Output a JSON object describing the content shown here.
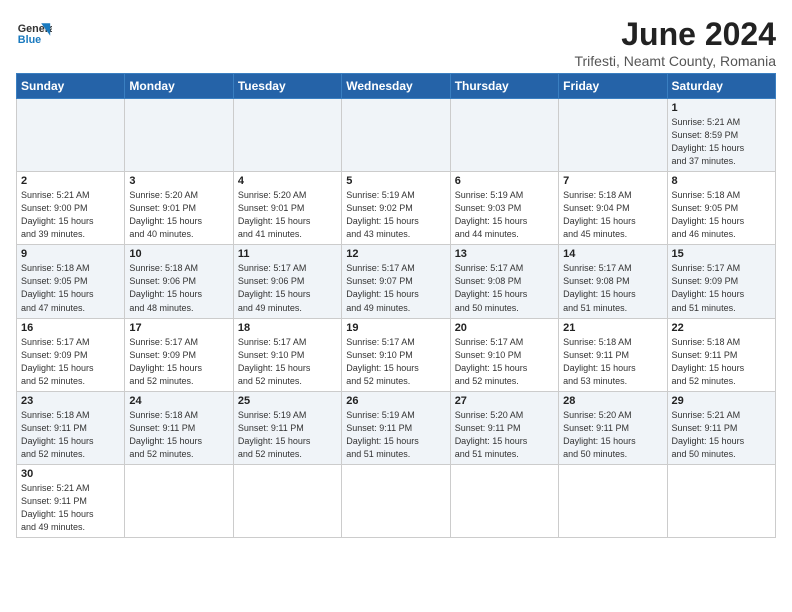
{
  "header": {
    "logo_general": "General",
    "logo_blue": "Blue",
    "month_year": "June 2024",
    "subtitle": "Trifesti, Neamt County, Romania"
  },
  "weekdays": [
    "Sunday",
    "Monday",
    "Tuesday",
    "Wednesday",
    "Thursday",
    "Friday",
    "Saturday"
  ],
  "weeks": [
    [
      {
        "day": "",
        "info": ""
      },
      {
        "day": "",
        "info": ""
      },
      {
        "day": "",
        "info": ""
      },
      {
        "day": "",
        "info": ""
      },
      {
        "day": "",
        "info": ""
      },
      {
        "day": "",
        "info": ""
      },
      {
        "day": "1",
        "info": "Sunrise: 5:21 AM\nSunset: 8:59 PM\nDaylight: 15 hours\nand 37 minutes."
      }
    ],
    [
      {
        "day": "2",
        "info": "Sunrise: 5:21 AM\nSunset: 9:00 PM\nDaylight: 15 hours\nand 39 minutes."
      },
      {
        "day": "3",
        "info": "Sunrise: 5:20 AM\nSunset: 9:01 PM\nDaylight: 15 hours\nand 40 minutes."
      },
      {
        "day": "4",
        "info": "Sunrise: 5:20 AM\nSunset: 9:01 PM\nDaylight: 15 hours\nand 41 minutes."
      },
      {
        "day": "5",
        "info": "Sunrise: 5:19 AM\nSunset: 9:02 PM\nDaylight: 15 hours\nand 43 minutes."
      },
      {
        "day": "6",
        "info": "Sunrise: 5:19 AM\nSunset: 9:03 PM\nDaylight: 15 hours\nand 44 minutes."
      },
      {
        "day": "7",
        "info": "Sunrise: 5:18 AM\nSunset: 9:04 PM\nDaylight: 15 hours\nand 45 minutes."
      },
      {
        "day": "8",
        "info": "Sunrise: 5:18 AM\nSunset: 9:05 PM\nDaylight: 15 hours\nand 46 minutes."
      }
    ],
    [
      {
        "day": "9",
        "info": "Sunrise: 5:18 AM\nSunset: 9:05 PM\nDaylight: 15 hours\nand 47 minutes."
      },
      {
        "day": "10",
        "info": "Sunrise: 5:18 AM\nSunset: 9:06 PM\nDaylight: 15 hours\nand 48 minutes."
      },
      {
        "day": "11",
        "info": "Sunrise: 5:17 AM\nSunset: 9:06 PM\nDaylight: 15 hours\nand 49 minutes."
      },
      {
        "day": "12",
        "info": "Sunrise: 5:17 AM\nSunset: 9:07 PM\nDaylight: 15 hours\nand 49 minutes."
      },
      {
        "day": "13",
        "info": "Sunrise: 5:17 AM\nSunset: 9:08 PM\nDaylight: 15 hours\nand 50 minutes."
      },
      {
        "day": "14",
        "info": "Sunrise: 5:17 AM\nSunset: 9:08 PM\nDaylight: 15 hours\nand 51 minutes."
      },
      {
        "day": "15",
        "info": "Sunrise: 5:17 AM\nSunset: 9:09 PM\nDaylight: 15 hours\nand 51 minutes."
      }
    ],
    [
      {
        "day": "16",
        "info": "Sunrise: 5:17 AM\nSunset: 9:09 PM\nDaylight: 15 hours\nand 52 minutes."
      },
      {
        "day": "17",
        "info": "Sunrise: 5:17 AM\nSunset: 9:09 PM\nDaylight: 15 hours\nand 52 minutes."
      },
      {
        "day": "18",
        "info": "Sunrise: 5:17 AM\nSunset: 9:10 PM\nDaylight: 15 hours\nand 52 minutes."
      },
      {
        "day": "19",
        "info": "Sunrise: 5:17 AM\nSunset: 9:10 PM\nDaylight: 15 hours\nand 52 minutes."
      },
      {
        "day": "20",
        "info": "Sunrise: 5:17 AM\nSunset: 9:10 PM\nDaylight: 15 hours\nand 52 minutes."
      },
      {
        "day": "21",
        "info": "Sunrise: 5:18 AM\nSunset: 9:11 PM\nDaylight: 15 hours\nand 53 minutes."
      },
      {
        "day": "22",
        "info": "Sunrise: 5:18 AM\nSunset: 9:11 PM\nDaylight: 15 hours\nand 52 minutes."
      }
    ],
    [
      {
        "day": "23",
        "info": "Sunrise: 5:18 AM\nSunset: 9:11 PM\nDaylight: 15 hours\nand 52 minutes."
      },
      {
        "day": "24",
        "info": "Sunrise: 5:18 AM\nSunset: 9:11 PM\nDaylight: 15 hours\nand 52 minutes."
      },
      {
        "day": "25",
        "info": "Sunrise: 5:19 AM\nSunset: 9:11 PM\nDaylight: 15 hours\nand 52 minutes."
      },
      {
        "day": "26",
        "info": "Sunrise: 5:19 AM\nSunset: 9:11 PM\nDaylight: 15 hours\nand 51 minutes."
      },
      {
        "day": "27",
        "info": "Sunrise: 5:20 AM\nSunset: 9:11 PM\nDaylight: 15 hours\nand 51 minutes."
      },
      {
        "day": "28",
        "info": "Sunrise: 5:20 AM\nSunset: 9:11 PM\nDaylight: 15 hours\nand 50 minutes."
      },
      {
        "day": "29",
        "info": "Sunrise: 5:21 AM\nSunset: 9:11 PM\nDaylight: 15 hours\nand 50 minutes."
      }
    ],
    [
      {
        "day": "30",
        "info": "Sunrise: 5:21 AM\nSunset: 9:11 PM\nDaylight: 15 hours\nand 49 minutes."
      },
      {
        "day": "",
        "info": ""
      },
      {
        "day": "",
        "info": ""
      },
      {
        "day": "",
        "info": ""
      },
      {
        "day": "",
        "info": ""
      },
      {
        "day": "",
        "info": ""
      },
      {
        "day": "",
        "info": ""
      }
    ]
  ]
}
